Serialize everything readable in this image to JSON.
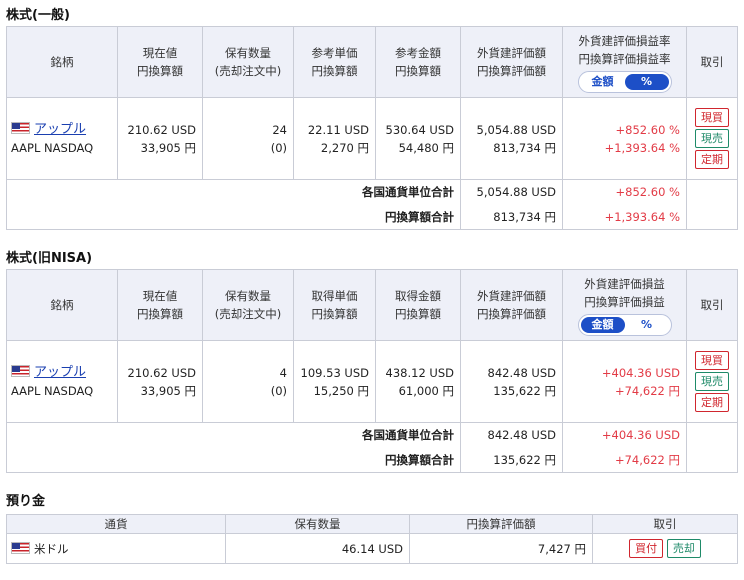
{
  "sections": {
    "general": {
      "title": "株式(一般)",
      "headers": {
        "name": "銘柄",
        "price": [
          "現在値",
          "円換算額"
        ],
        "qty": [
          "保有数量",
          "(売却注文中)"
        ],
        "unit": [
          "参考単価",
          "円換算額"
        ],
        "amount": [
          "参考金額",
          "円換算額"
        ],
        "valuation": [
          "外貨建評価額",
          "円換算評価額"
        ],
        "pl": [
          "外貨建評価損益率",
          "円換算評価損益率"
        ],
        "trade": "取引"
      },
      "toggle": {
        "left": "金額",
        "right": "%"
      },
      "row": {
        "name": "アップル",
        "market": "AAPL NASDAQ",
        "price": "210.62 USD",
        "price_jpy": "33,905 円",
        "qty": "24",
        "qty_pending": "(0)",
        "unit": "22.11 USD",
        "unit_jpy": "2,270 円",
        "amount": "530.64 USD",
        "amount_jpy": "54,480 円",
        "valuation": "5,054.88 USD",
        "valuation_jpy": "813,734 円",
        "pl": "+852.60 %",
        "pl_jpy": "+1,393.64 %",
        "buttons": [
          "現買",
          "現売",
          "定期"
        ]
      },
      "summary": [
        {
          "label": "各国通貨単位合計",
          "value": "5,054.88 USD",
          "pl": "+852.60 %"
        },
        {
          "label": "円換算額合計",
          "value": "813,734 円",
          "pl": "+1,393.64 %"
        }
      ]
    },
    "nisa": {
      "title": "株式(旧NISA)",
      "headers": {
        "name": "銘柄",
        "price": [
          "現在値",
          "円換算額"
        ],
        "qty": [
          "保有数量",
          "(売却注文中)"
        ],
        "unit": [
          "取得単価",
          "円換算額"
        ],
        "amount": [
          "取得金額",
          "円換算額"
        ],
        "valuation": [
          "外貨建評価額",
          "円換算評価額"
        ],
        "pl": [
          "外貨建評価損益",
          "円換算評価損益"
        ],
        "trade": "取引"
      },
      "toggle": {
        "left": "金額",
        "right": "%"
      },
      "row": {
        "name": "アップル",
        "market": "AAPL NASDAQ",
        "price": "210.62 USD",
        "price_jpy": "33,905 円",
        "qty": "4",
        "qty_pending": "(0)",
        "unit": "109.53 USD",
        "unit_jpy": "15,250 円",
        "amount": "438.12 USD",
        "amount_jpy": "61,000 円",
        "valuation": "842.48 USD",
        "valuation_jpy": "135,622 円",
        "pl": "+404.36 USD",
        "pl_jpy": "+74,622 円",
        "buttons": [
          "現買",
          "現売",
          "定期"
        ]
      },
      "summary": [
        {
          "label": "各国通貨単位合計",
          "value": "842.48 USD",
          "pl": "+404.36 USD"
        },
        {
          "label": "円換算額合計",
          "value": "135,622 円",
          "pl": "+74,622 円"
        }
      ]
    },
    "deposit": {
      "title": "預り金",
      "headers": {
        "currency": "通貨",
        "qty": "保有数量",
        "jpy": "円換算評価額",
        "trade": "取引"
      },
      "row": {
        "currency": "米ドル",
        "qty": "46.14 USD",
        "jpy": "7,427 円",
        "buttons": [
          "買付",
          "売却"
        ]
      }
    }
  },
  "colors": {
    "accent": "#1d4fc7",
    "gain": "#e23b46",
    "sell": "#1e8a68"
  }
}
